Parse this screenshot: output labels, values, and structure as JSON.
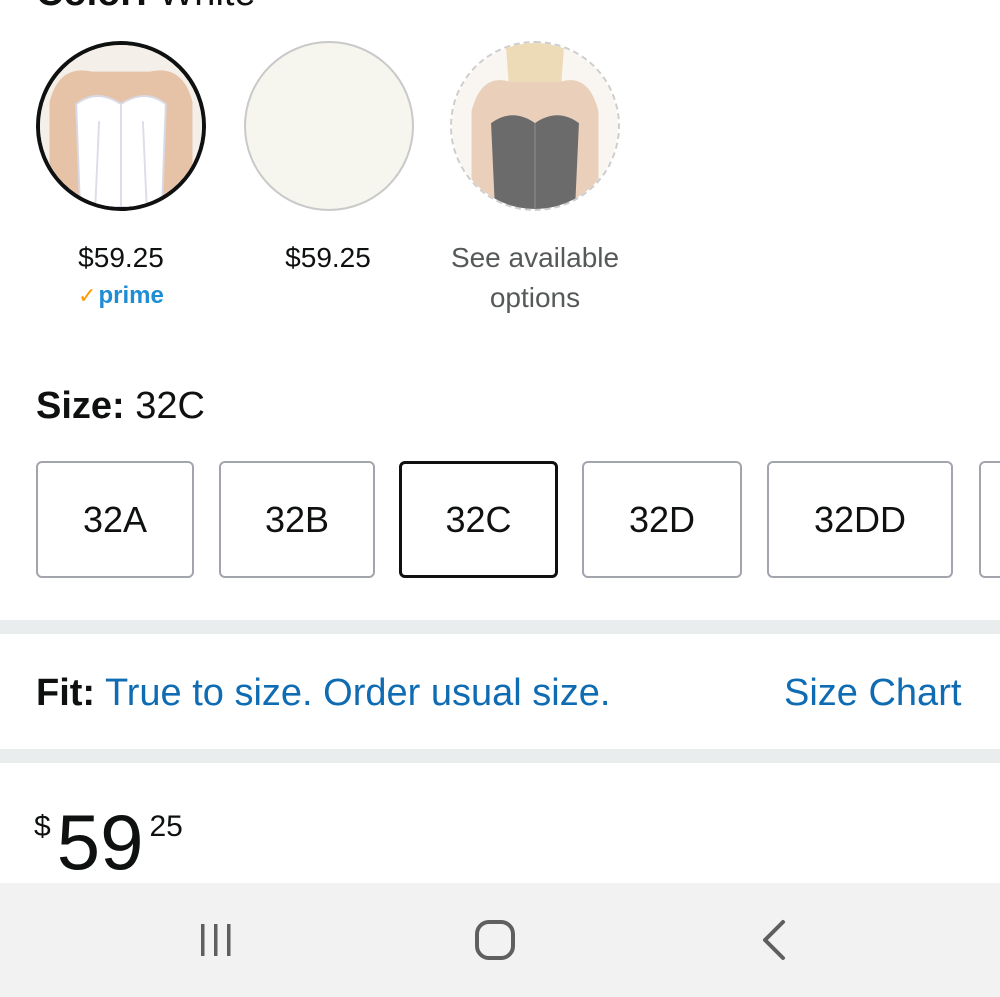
{
  "color": {
    "label": "Color:",
    "value": "White"
  },
  "swatches": [
    {
      "price": "$59.25",
      "badge": "prime"
    },
    {
      "price": "$59.25"
    },
    {
      "price": "See available options"
    }
  ],
  "size": {
    "label": "Size:",
    "value": "32C",
    "options": [
      "32A",
      "32B",
      "32C",
      "32D",
      "32DD",
      ""
    ],
    "selected": "32C"
  },
  "fit": {
    "label": "Fit:",
    "text": "True to size. Order usual size.",
    "size_chart": "Size Chart"
  },
  "price": {
    "symbol": "$",
    "whole": "59",
    "fraction": "25"
  },
  "nav": {
    "icons": [
      "recent-apps-icon",
      "home-icon",
      "back-icon"
    ]
  },
  "colors": {
    "link": "#0f6cb3",
    "prime": "#1f8dd6",
    "prime_check": "#ff9900"
  }
}
